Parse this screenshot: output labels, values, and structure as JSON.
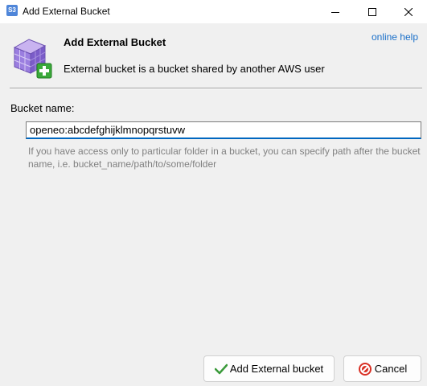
{
  "window": {
    "app_icon_text": "S3",
    "title": "Add External Bucket",
    "controls": [
      "minimize-icon",
      "maximize-icon",
      "close-icon"
    ]
  },
  "header": {
    "icon": "bucket-add-icon",
    "title": "Add External Bucket",
    "description": "External bucket is a bucket shared by another AWS user",
    "help_link": "online help"
  },
  "form": {
    "bucket_label": "Bucket name:",
    "bucket_value": "openeo:abcdefghijklmnopqrstuvw",
    "hint": "If you have access only to particular folder in a bucket, you can specify path after the bucket name, i.e. bucket_name/path/to/some/folder"
  },
  "buttons": {
    "add_label": "Add External bucket",
    "add_icon": "checkmark-icon",
    "cancel_label": "Cancel",
    "cancel_icon": "cancel-icon"
  },
  "colors": {
    "link": "#1a6fc9",
    "focus_underline": "#0067c0",
    "hint_text": "#808080",
    "background": "#f0f0f0"
  }
}
